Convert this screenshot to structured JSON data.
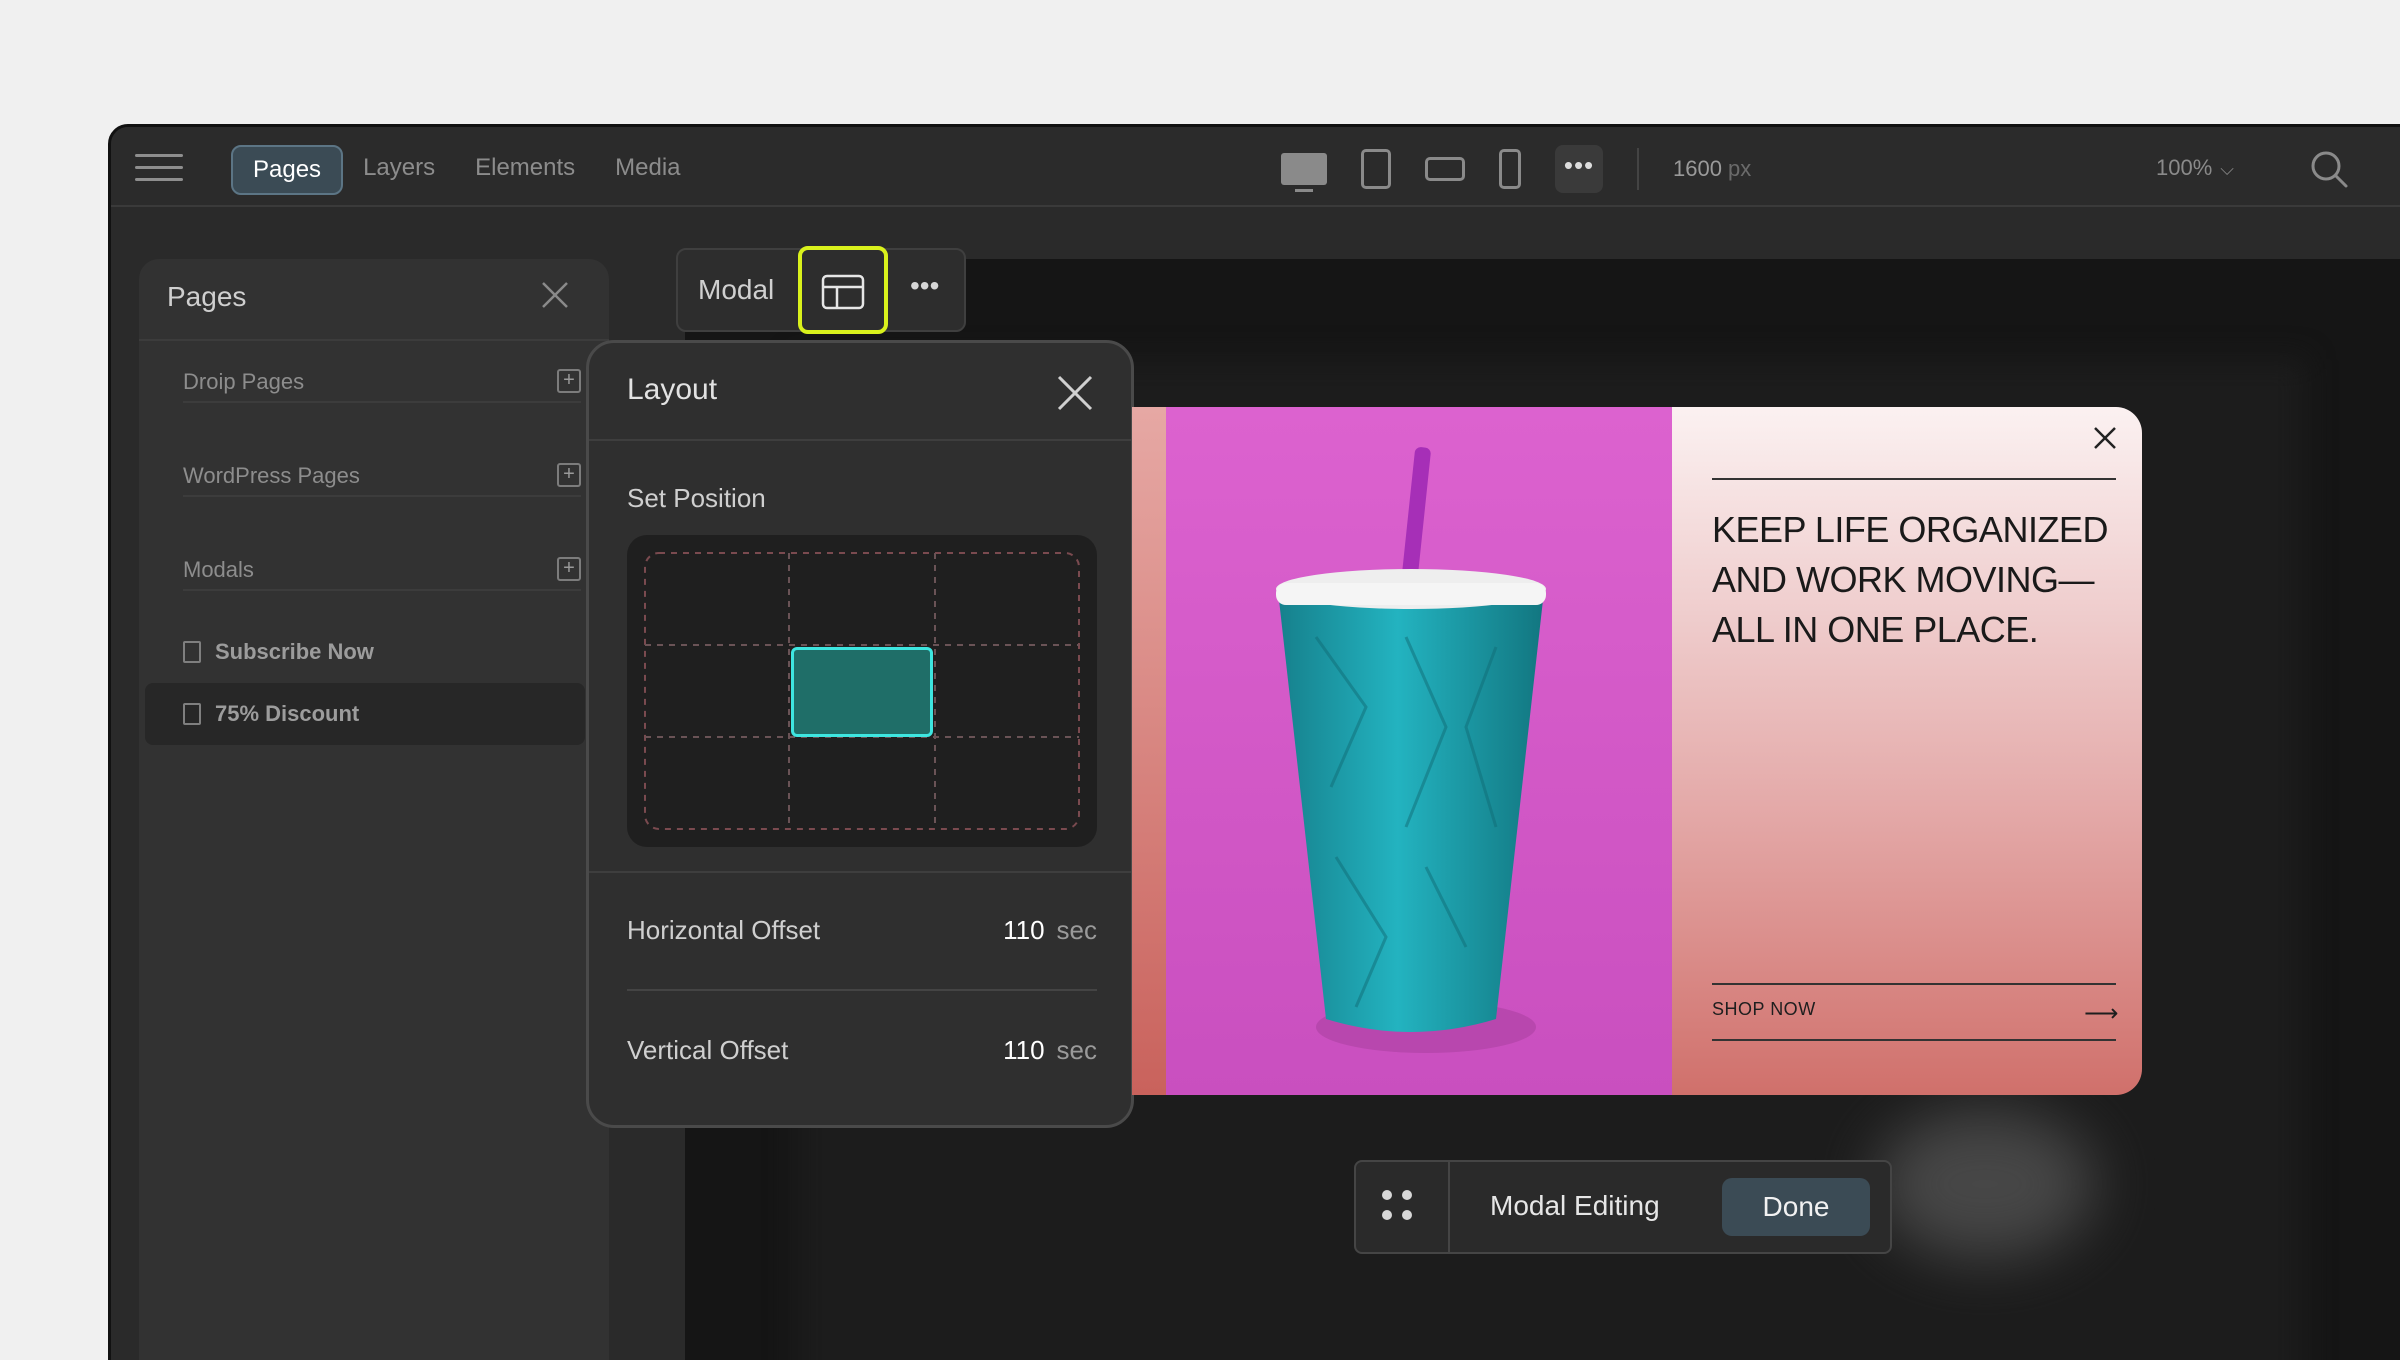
{
  "topbar": {
    "tabs": [
      {
        "label": "Pages",
        "active": true
      },
      {
        "label": "Layers",
        "active": false
      },
      {
        "label": "Elements",
        "active": false
      },
      {
        "label": "Media",
        "active": false
      }
    ],
    "width_value": "1600",
    "width_unit": "px",
    "zoom": "100%"
  },
  "pages_panel": {
    "title": "Pages",
    "sections": [
      "Droip Pages",
      "WordPress Pages",
      "Modals"
    ],
    "modal_items": [
      "Subscribe Now",
      "75% Discount"
    ],
    "selected_item": "75% Discount"
  },
  "modal_toolbar": {
    "label": "Modal",
    "more": "•••"
  },
  "layout_popover": {
    "title": "Layout",
    "set_position_label": "Set Position",
    "selected_position": "center",
    "horizontal_offset": {
      "label": "Horizontal Offset",
      "value": "110",
      "unit": "sec"
    },
    "vertical_offset": {
      "label": "Vertical Offset",
      "value": "110",
      "unit": "sec"
    }
  },
  "modal_preview": {
    "headline": "KEEP LIFE ORGANIZED AND WORK MOVING—ALL IN ONE PLACE.",
    "cta": "SHOP NOW",
    "cta_arrow": "⟶"
  },
  "edit_bar": {
    "label": "Modal Editing",
    "done_label": "Done"
  },
  "colors": {
    "accent_highlight": "#d9f11c",
    "grid_selected": "#1f6e68",
    "grid_selected_border": "#3ee6e0",
    "photo_bg": "#d155c4",
    "cup": "#1ea7b3"
  }
}
